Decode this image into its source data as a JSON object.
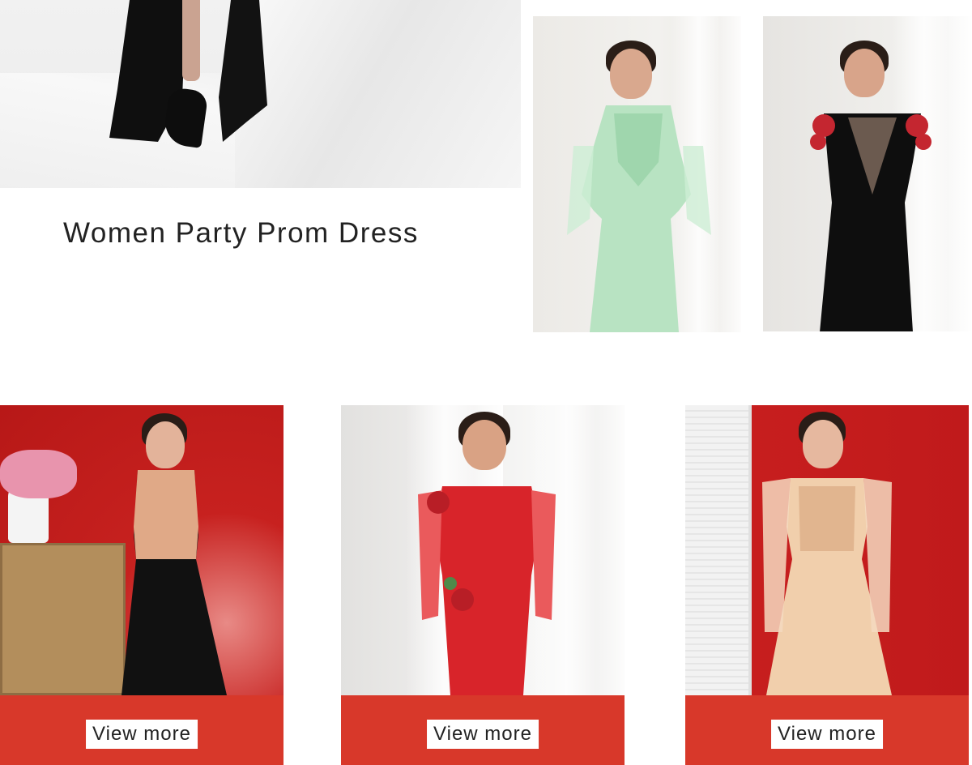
{
  "collection": {
    "title": "Women Party Prom Dress"
  },
  "cards": [
    {
      "button_label": "View more"
    },
    {
      "button_label": "View more"
    },
    {
      "button_label": "View more"
    }
  ],
  "colors": {
    "accent_red": "#d8382a",
    "button_bg": "#ffffff",
    "title_text": "#222222"
  }
}
